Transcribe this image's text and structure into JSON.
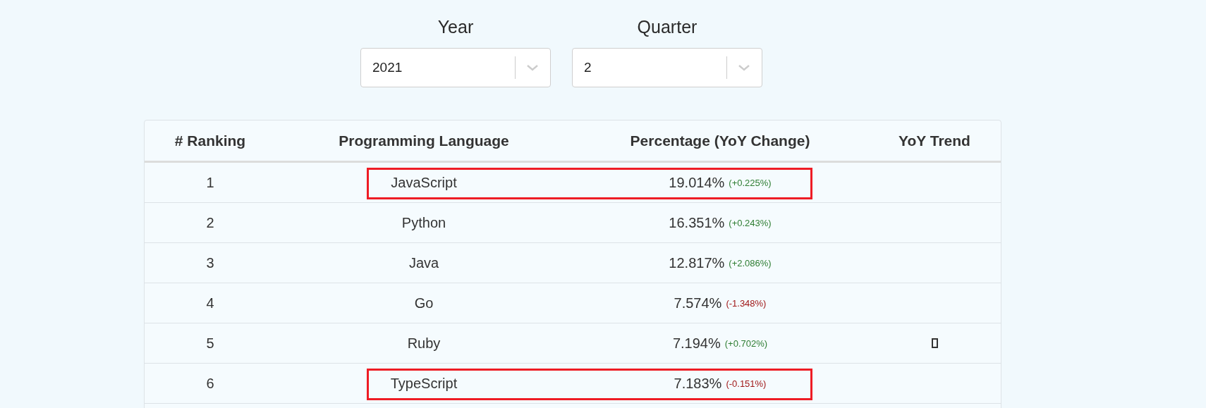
{
  "filters": [
    {
      "label": "Year",
      "value": "2021"
    },
    {
      "label": "Quarter",
      "value": "2"
    }
  ],
  "table": {
    "columns": [
      "# Ranking",
      "Programming Language",
      "Percentage (YoY Change)",
      "YoY Trend"
    ],
    "rows": [
      {
        "rank": "1",
        "language": "JavaScript",
        "percentage": "19.014%",
        "change": "(+0.225%)",
        "negative": false,
        "trend_icon": false,
        "highlighted": true
      },
      {
        "rank": "2",
        "language": "Python",
        "percentage": "16.351%",
        "change": "(+0.243%)",
        "negative": false,
        "trend_icon": false,
        "highlighted": false
      },
      {
        "rank": "3",
        "language": "Java",
        "percentage": "12.817%",
        "change": "(+2.086%)",
        "negative": false,
        "trend_icon": false,
        "highlighted": false
      },
      {
        "rank": "4",
        "language": "Go",
        "percentage": "7.574%",
        "change": "(-1.348%)",
        "negative": true,
        "trend_icon": false,
        "highlighted": false
      },
      {
        "rank": "5",
        "language": "Ruby",
        "percentage": "7.194%",
        "change": "(+0.702%)",
        "negative": false,
        "trend_icon": true,
        "highlighted": false
      },
      {
        "rank": "6",
        "language": "TypeScript",
        "percentage": "7.183%",
        "change": "(-0.151%)",
        "negative": true,
        "trend_icon": false,
        "highlighted": true
      }
    ]
  }
}
